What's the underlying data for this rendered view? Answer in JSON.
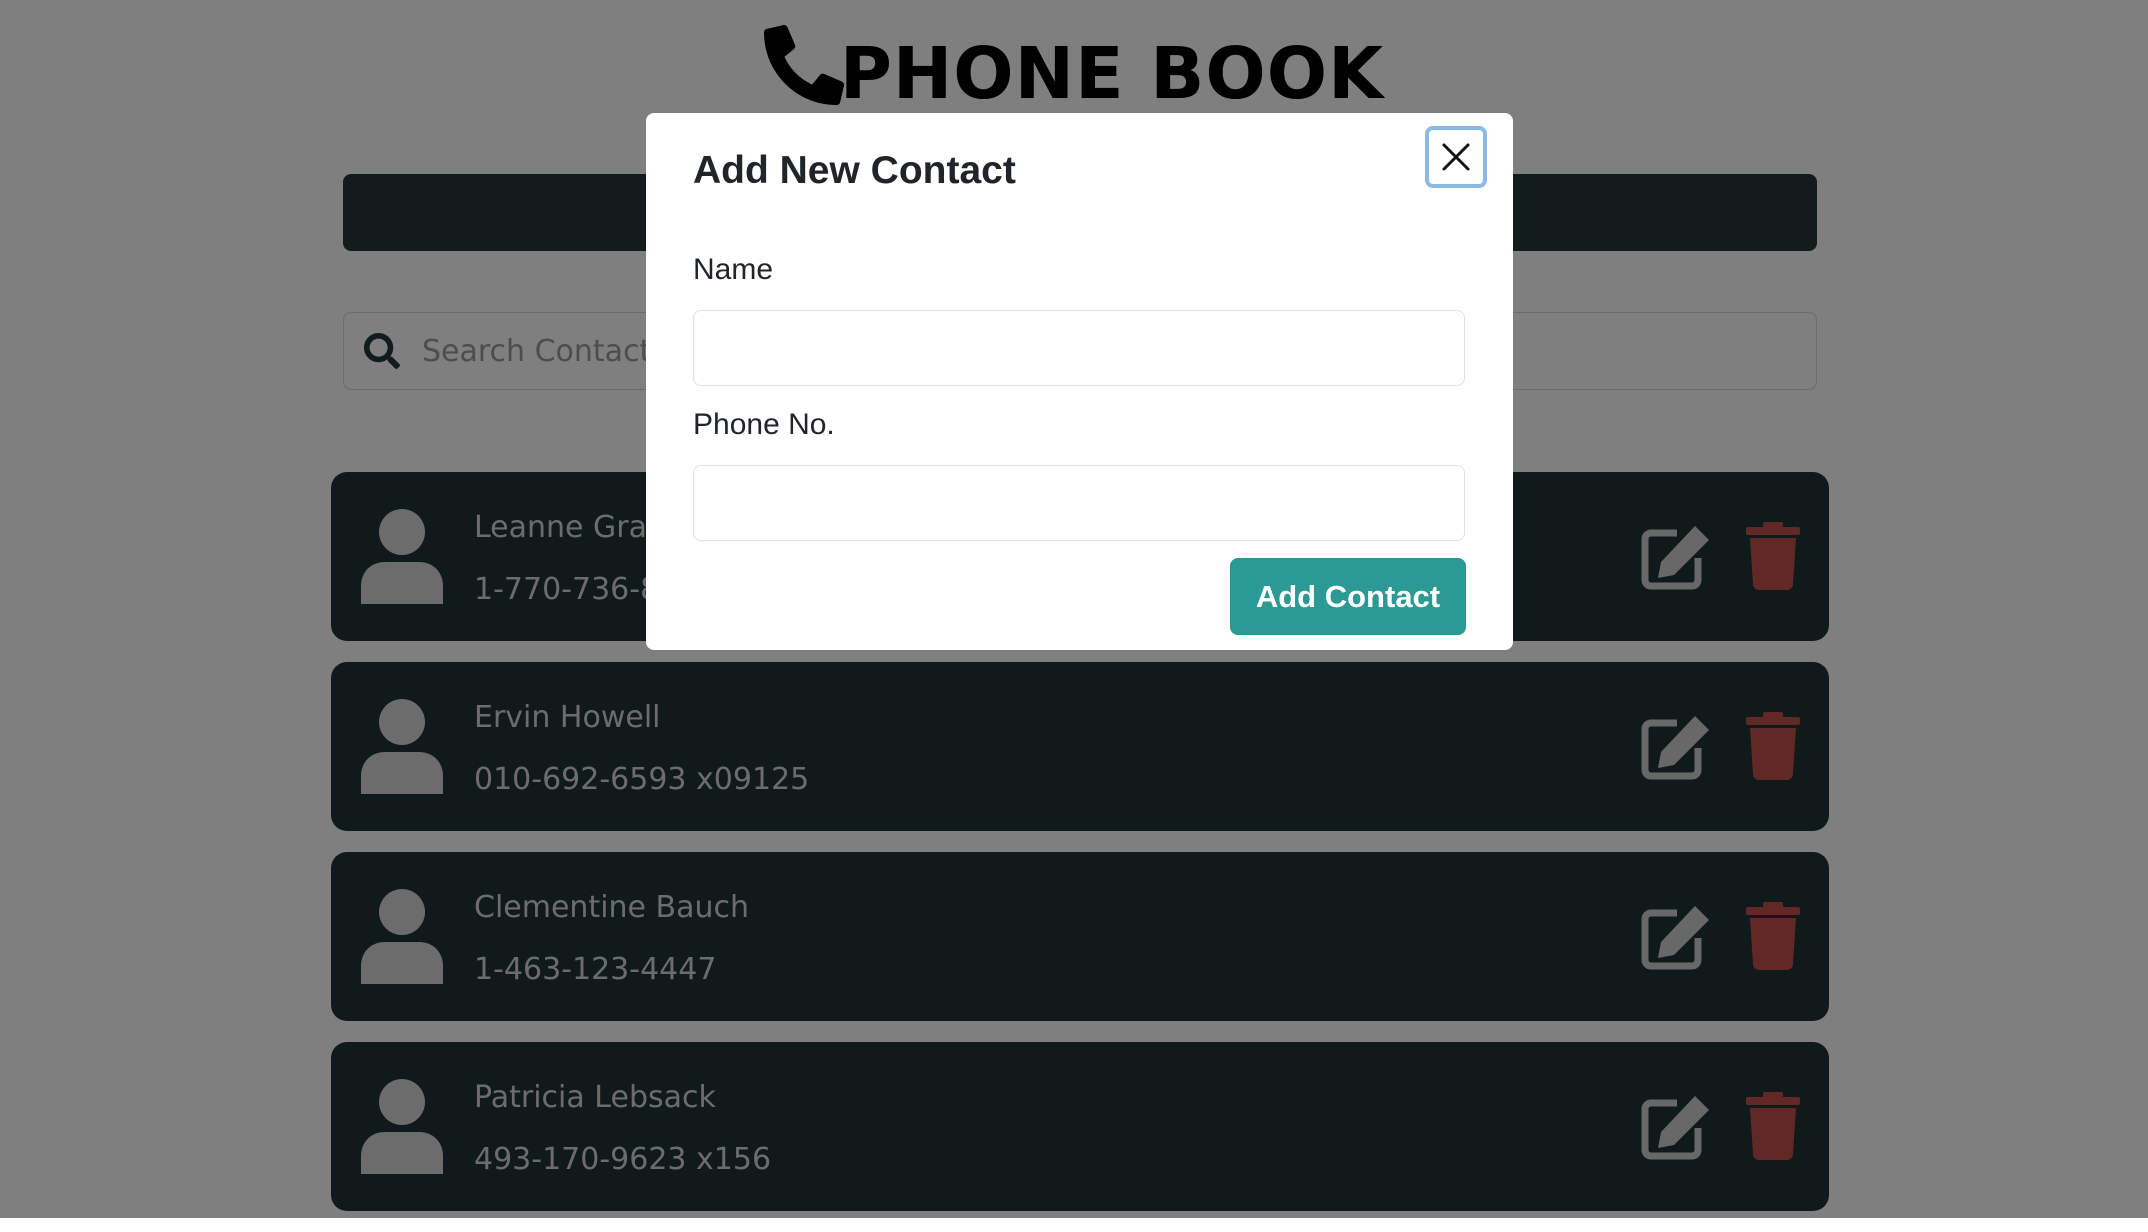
{
  "app": {
    "title": "PHONE BOOK",
    "phone_icon": "phone-icon",
    "add_bar_color": "#26393a",
    "search": {
      "placeholder": "Search Contact...",
      "icon": "search-icon"
    }
  },
  "contacts": [
    {
      "name": "Leanne Graham",
      "phone": "1-770-736-8031 x56442"
    },
    {
      "name": "Ervin Howell",
      "phone": "010-692-6593 x09125"
    },
    {
      "name": "Clementine Bauch",
      "phone": "1-463-123-4447"
    },
    {
      "name": "Patricia Lebsack",
      "phone": "493-170-9623 x156"
    }
  ],
  "card_icons": {
    "avatar": "user-icon",
    "edit": "edit-icon",
    "delete": "trash-icon"
  },
  "colors": {
    "card_bg": "#203437",
    "delete_icon": "#c0524b",
    "edit_icon": "#d0d0d0",
    "primary_button": "#2c9a94"
  },
  "modal": {
    "title": "Add New Contact",
    "name_label": "Name",
    "name_value": "",
    "phone_label": "Phone No.",
    "phone_value": "",
    "submit_label": "Add Contact",
    "close_icon": "close-icon"
  }
}
